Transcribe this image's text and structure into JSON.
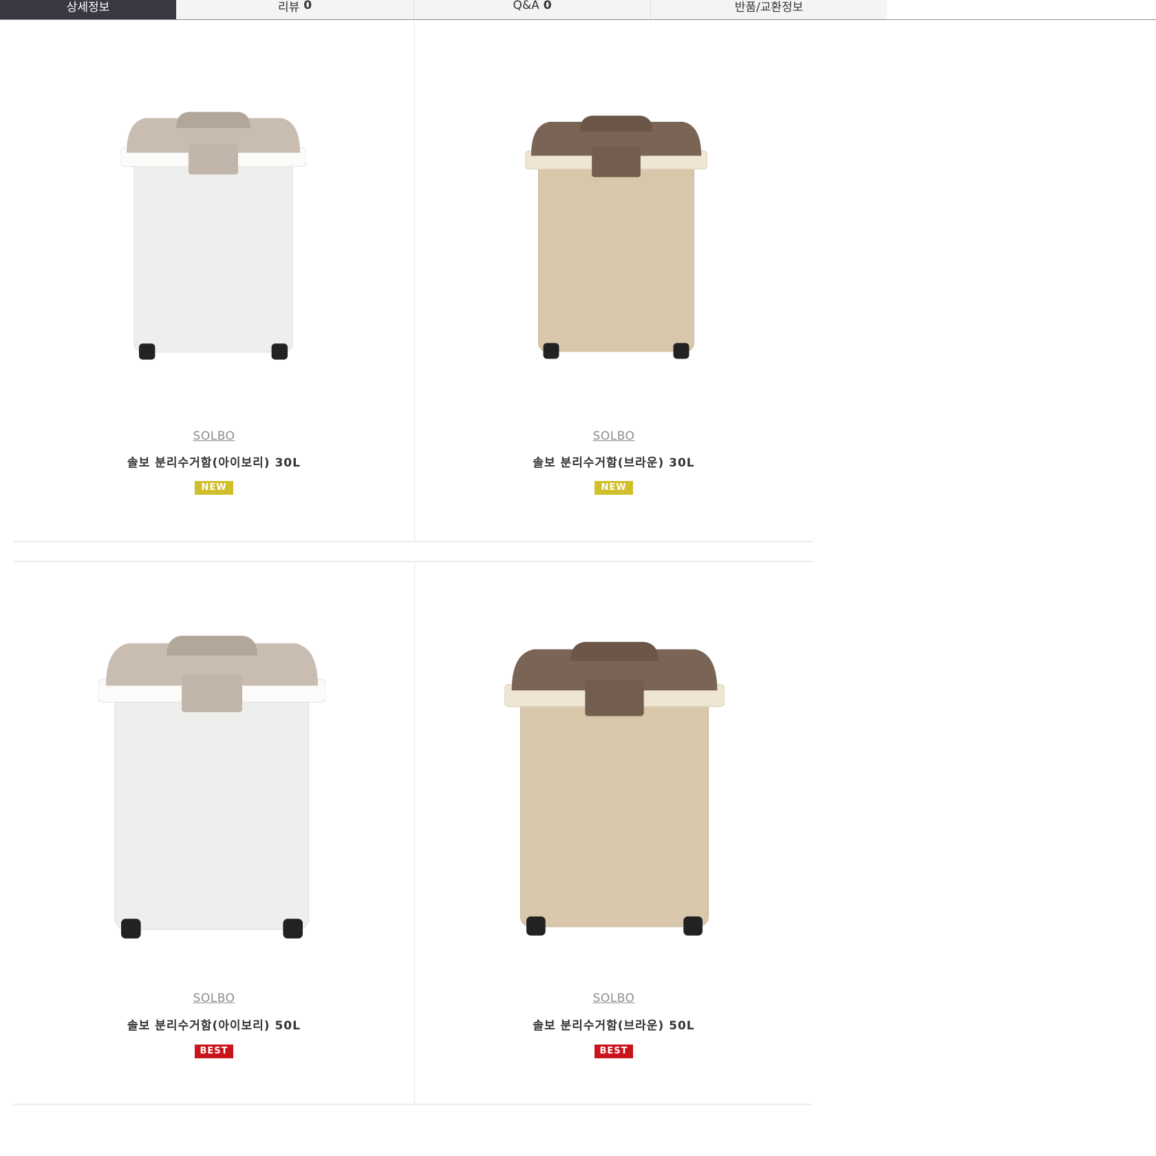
{
  "tabs": [
    {
      "label": "상세정보",
      "count": ""
    },
    {
      "label": "리뷰",
      "count": "0"
    },
    {
      "label": "Q&A",
      "count": "0"
    },
    {
      "label": "반품/교환정보",
      "count": ""
    }
  ],
  "products": [
    {
      "brand": "SOLBO",
      "name": "솔보 분리수거함(아이보리) 30L",
      "badge": "NEW",
      "image": "ivory-bin-icon"
    },
    {
      "brand": "SOLBO",
      "name": "솔보 분리수거함(브라운) 30L",
      "badge": "NEW",
      "image": "brown-bin-icon"
    },
    {
      "brand": "SOLBO",
      "name": "솔보 분리수거함(아이보리) 50L",
      "badge": "BEST",
      "image": "ivory-bin-icon"
    },
    {
      "brand": "SOLBO",
      "name": "솔보 분리수거함(브라운) 50L",
      "badge": "BEST",
      "image": "brown-bin-icon"
    }
  ],
  "colors": {
    "active_tab": "#3a3843",
    "tab_bg": "#f3f4f5",
    "badge_new": "#cfbf2a",
    "badge_best": "#c8141b",
    "ivory_lid": "#c9bdb2",
    "ivory_body": "#eeeeec",
    "brown_lid": "#7a6455",
    "brown_body": "#d8c7aa"
  }
}
